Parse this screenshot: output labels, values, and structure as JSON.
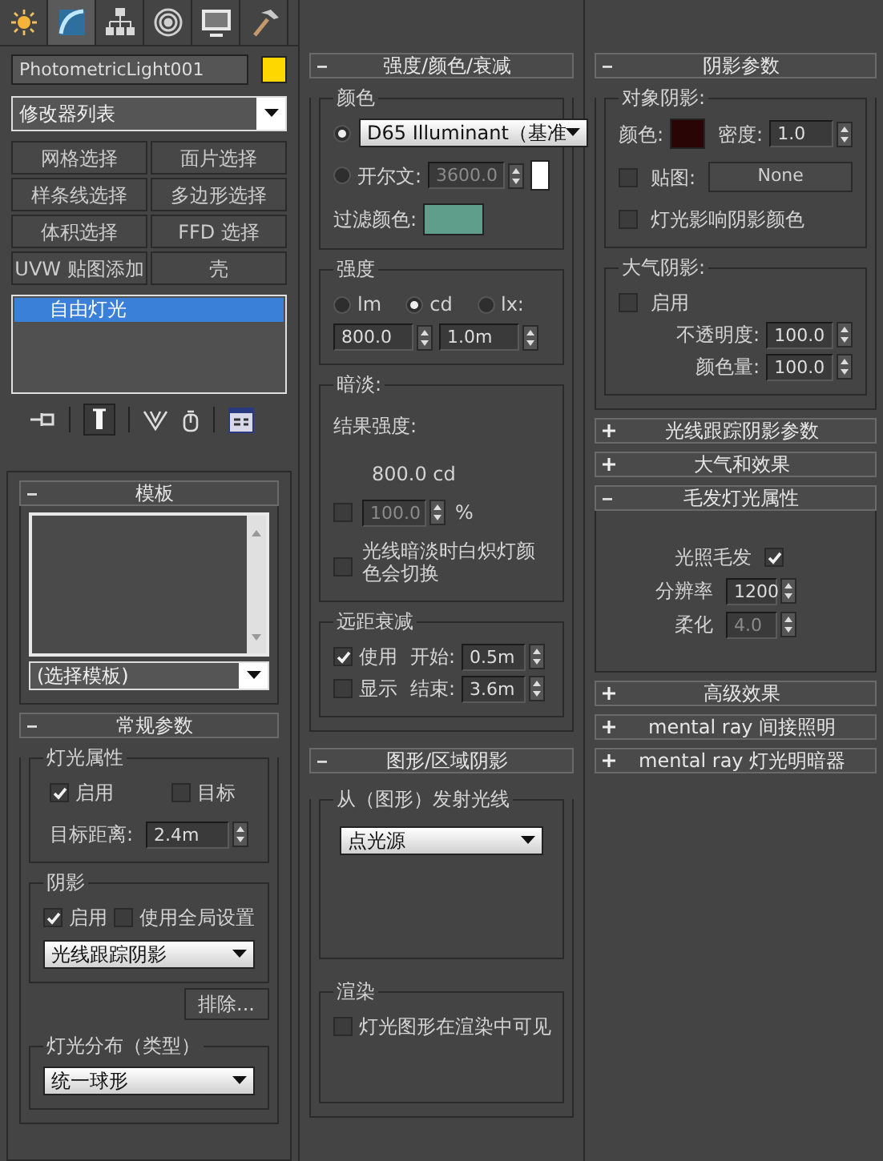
{
  "tabs": [
    {
      "kind": "create",
      "selected": false
    },
    {
      "kind": "modify",
      "selected": true
    },
    {
      "kind": "hierarchy",
      "selected": false
    },
    {
      "kind": "motion",
      "selected": false
    },
    {
      "kind": "display",
      "selected": false
    },
    {
      "kind": "utilities",
      "selected": false
    }
  ],
  "object": {
    "name": "PhotometricLight001",
    "color": "#ffd700"
  },
  "modifier_list": {
    "value": "修改器列表"
  },
  "modifier_buttons": [
    "网格选择",
    "面片选择",
    "样条线选择",
    "多边形选择",
    "体积选择",
    "FFD 选择",
    "UVW 贴图添加",
    "壳"
  ],
  "stack": {
    "items": [
      {
        "label": "自由灯光",
        "selected": true
      }
    ]
  },
  "columns": [
    {
      "rollouts": [
        {
          "kind": "template",
          "title": "模板",
          "expanded": true,
          "dropdown": "(选择模板)"
        },
        {
          "kind": "general",
          "title": "常规参数",
          "expanded": true,
          "light_props": {
            "title": "灯光属性",
            "enabled": {
              "label": "启用",
              "checked": true
            },
            "target": {
              "label": "目标",
              "checked": false
            },
            "target_distance": {
              "label": "目标距离:",
              "value": "2.4m"
            }
          },
          "shadows": {
            "title": "阴影",
            "enabled": {
              "label": "启用",
              "checked": true
            },
            "use_global": {
              "label": "使用全局设置",
              "checked": false
            },
            "type": "光线跟踪阴影"
          },
          "exclude_button": "排除...",
          "distribution": {
            "title": "灯光分布（类型）",
            "value": "统一球形"
          }
        }
      ]
    },
    {
      "rollouts": [
        {
          "kind": "intensity",
          "title": "强度/颜色/衰减",
          "expanded": true,
          "color_group": {
            "title": "颜色",
            "preset": {
              "selected": true,
              "value": "D65 Illuminant（基准"
            },
            "kelvin": {
              "selected": false,
              "label": "开尔文:",
              "value": "3600.0",
              "disabled": true,
              "color": "#ffffff"
            },
            "filter": {
              "label": "过滤颜色:",
              "color": "#5f9e8a"
            }
          },
          "intensity_group": {
            "title": "强度",
            "units": [
              {
                "label": "lm",
                "selected": false
              },
              {
                "label": "cd",
                "selected": true
              },
              {
                "label": "lx:",
                "selected": false
              }
            ],
            "value": "800.0",
            "distance": "1.0m"
          },
          "dimming": {
            "title": "暗淡:",
            "result_label": "结果强度:",
            "result": "800.0 cd",
            "percent": {
              "checked": false,
              "value": "100.0",
              "disabled": true,
              "unit": "%"
            },
            "incandescent": {
              "checked": false,
              "label": "光线暗淡时白炽灯颜色会切换"
            }
          },
          "far_attenuation": {
            "title": "远距衰减",
            "use": {
              "label": "使用",
              "checked": true
            },
            "show": {
              "label": "显示",
              "checked": false
            },
            "start": {
              "label": "开始:",
              "value": "0.5m"
            },
            "end": {
              "label": "结束:",
              "value": "3.6m"
            }
          }
        },
        {
          "kind": "shape",
          "title": "图形/区域阴影",
          "expanded": true,
          "emit": {
            "title": "从（图形）发射光线",
            "value": "点光源"
          },
          "render": {
            "title": "渲染",
            "visible": {
              "label": "灯光图形在渲染中可见",
              "checked": false
            }
          }
        }
      ]
    },
    {
      "rollouts": [
        {
          "kind": "shadow_params",
          "title": "阴影参数",
          "expanded": true,
          "object_shadows": {
            "title": "对象阴影:",
            "color_label": "颜色:",
            "color": "#2a0505",
            "density_label": "密度:",
            "density": "1.0",
            "map": {
              "label": "贴图:",
              "checked": false,
              "button": "None"
            },
            "light_affects": {
              "label": "灯光影响阴影颜色",
              "checked": false
            }
          },
          "atmosphere": {
            "title": "大气阴影:",
            "enabled": {
              "label": "启用",
              "checked": false
            },
            "opacity": {
              "label": "不透明度:",
              "value": "100.0"
            },
            "color_amount": {
              "label": "颜色量:",
              "value": "100.0"
            }
          }
        },
        {
          "kind": "generic",
          "title": "光线跟踪阴影参数",
          "expanded": false
        },
        {
          "kind": "generic",
          "title": "大气和效果",
          "expanded": false
        },
        {
          "kind": "hair",
          "title": "毛发灯光属性",
          "expanded": true,
          "light_hair": {
            "label": "光照毛发",
            "checked": true
          },
          "resolution": {
            "label": "分辨率",
            "value": "1200",
            "disabled": false
          },
          "soften": {
            "label": "柔化",
            "value": "4.0",
            "disabled": true
          }
        },
        {
          "kind": "generic",
          "title": "高级效果",
          "expanded": false
        },
        {
          "kind": "generic",
          "title": "mental ray 间接照明",
          "expanded": false
        },
        {
          "kind": "generic",
          "title": "mental ray 灯光明暗器",
          "expanded": false
        }
      ]
    }
  ]
}
